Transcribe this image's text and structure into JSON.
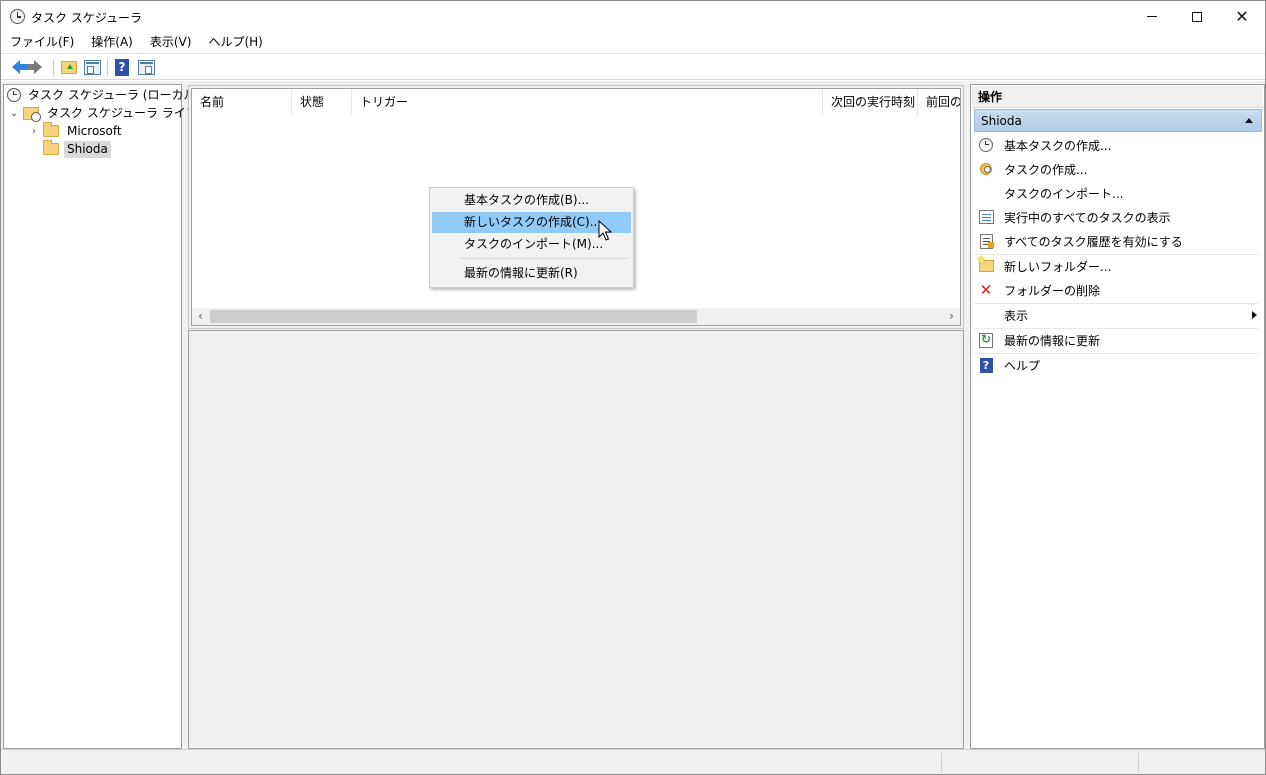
{
  "window": {
    "title": "タスク スケジューラ"
  },
  "menubar": {
    "items": [
      "ファイル(F)",
      "操作(A)",
      "表示(V)",
      "ヘルプ(H)"
    ]
  },
  "toolbar": {
    "icons": [
      "back-arrow-icon",
      "forward-arrow-icon",
      "folder-up-icon",
      "show-hide-console-tree-icon",
      "help-icon",
      "show-hide-action-pane-icon"
    ]
  },
  "tree": {
    "root": "タスク スケジューラ (ローカル)",
    "library": "タスク スケジューラ ライブラリ",
    "folders": [
      "Microsoft",
      "Shioda"
    ],
    "selected": "Shioda"
  },
  "task_list": {
    "columns": [
      "名前",
      "状態",
      "トリガー",
      "次回の実行時刻",
      "前回の実行時刻"
    ]
  },
  "context_menu": {
    "items": [
      "基本タスクの作成(B)...",
      "新しいタスクの作成(C)...",
      "タスクのインポート(M)...",
      "最新の情報に更新(R)"
    ],
    "highlighted": "新しいタスクの作成(C)..."
  },
  "actions": {
    "header": "操作",
    "section": "Shioda",
    "items": [
      {
        "label": "基本タスクの作成...",
        "icon": "clock-icon"
      },
      {
        "label": "タスクの作成...",
        "icon": "new-task-icon"
      },
      {
        "label": "タスクのインポート...",
        "icon": ""
      },
      {
        "label": "実行中のすべてのタスクの表示",
        "icon": "running-tasks-icon"
      },
      {
        "label": "すべてのタスク履歴を有効にする",
        "icon": "history-icon"
      },
      {
        "label": "新しいフォルダー...",
        "icon": "new-folder-icon"
      },
      {
        "label": "フォルダーの削除",
        "icon": "delete-icon"
      },
      {
        "label": "表示",
        "icon": ""
      },
      {
        "label": "最新の情報に更新",
        "icon": "refresh-icon"
      },
      {
        "label": "ヘルプ",
        "icon": "help-icon"
      }
    ]
  },
  "colors": {
    "menu_highlight": "#91c9f7",
    "section_header": "#b8d0ea",
    "delete_red": "#d32020"
  }
}
